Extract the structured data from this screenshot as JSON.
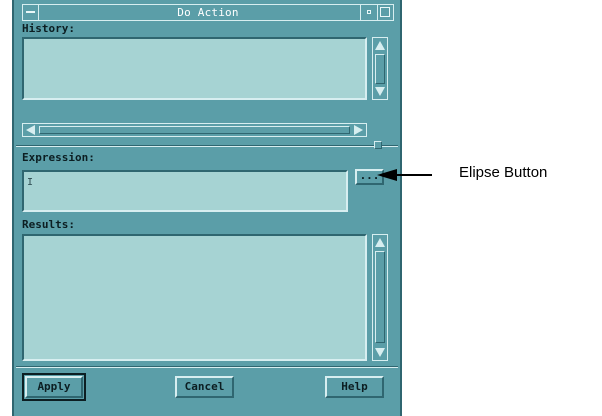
{
  "window": {
    "title": "Do Action",
    "menu_icon": "window-menu-icon",
    "minimize_icon": "minimize-icon",
    "maximize_icon": "maximize-icon"
  },
  "history": {
    "label": "History:",
    "value": ""
  },
  "expression": {
    "label": "Expression:",
    "value": "",
    "ellipse_button_label": "..."
  },
  "results": {
    "label": "Results:",
    "value": ""
  },
  "buttons": {
    "apply": "Apply",
    "cancel": "Cancel",
    "help": "Help"
  },
  "annotation": {
    "text": "Elipse Button"
  },
  "colors": {
    "panel": "#5b9ea8",
    "field": "#a6d3d3",
    "shadow": "#2f6670",
    "highlight": "#d7eef0"
  }
}
